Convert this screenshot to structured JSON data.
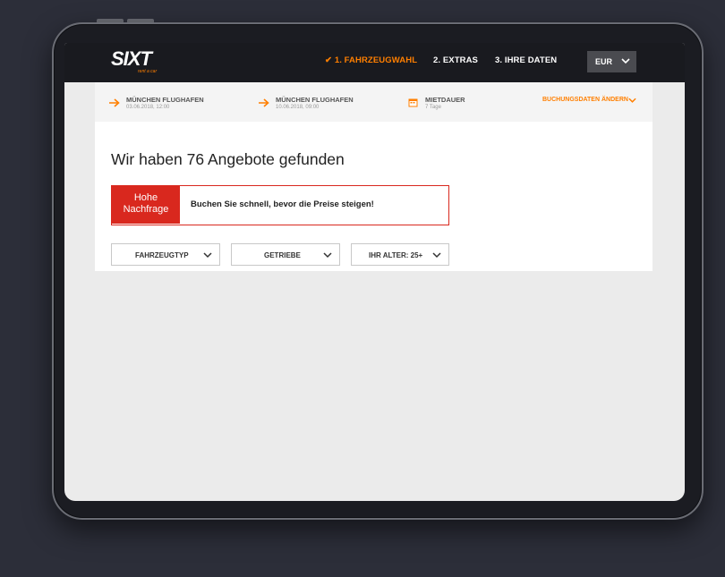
{
  "header": {
    "logo_text": "SIXT",
    "logo_tagline": "rent a car",
    "steps": [
      {
        "label": "1. FAHRZEUGWAHL",
        "check": "✔",
        "active": true
      },
      {
        "label": "2. EXTRAS",
        "active": false
      },
      {
        "label": "3. IHRE DATEN",
        "active": false
      }
    ],
    "currency": "EUR"
  },
  "booking": {
    "pickup": {
      "location": "MÜNCHEN FLUGHAFEN",
      "date": "03.06.2018, 12:00"
    },
    "return": {
      "location": "MÜNCHEN FLUGHAFEN",
      "date": "10.06.2018, 09:00"
    },
    "duration": {
      "label": "MIETDAUER",
      "value": "7 Tage"
    },
    "change_label": "BUCHUNGSDATEN ÄNDERN"
  },
  "main": {
    "headline": "Wir haben 76 Angebote gefunden",
    "banner": {
      "tag_line1": "Hohe",
      "tag_line2": "Nachfrage",
      "message": "Buchen Sie schnell, bevor die Preise steigen!"
    },
    "filters": [
      {
        "label": "FAHRZEUGTYP"
      },
      {
        "label": "GETRIEBE"
      },
      {
        "label": "IHR ALTER: 25+"
      }
    ]
  },
  "colors": {
    "accent": "#ff7f00",
    "alert": "#d9281e",
    "header_bg": "#191a1f",
    "device_bg": "#2c2e39"
  },
  "icons": [
    "arrow-right-icon",
    "calendar-icon",
    "chevron-down-icon",
    "check-icon"
  ]
}
